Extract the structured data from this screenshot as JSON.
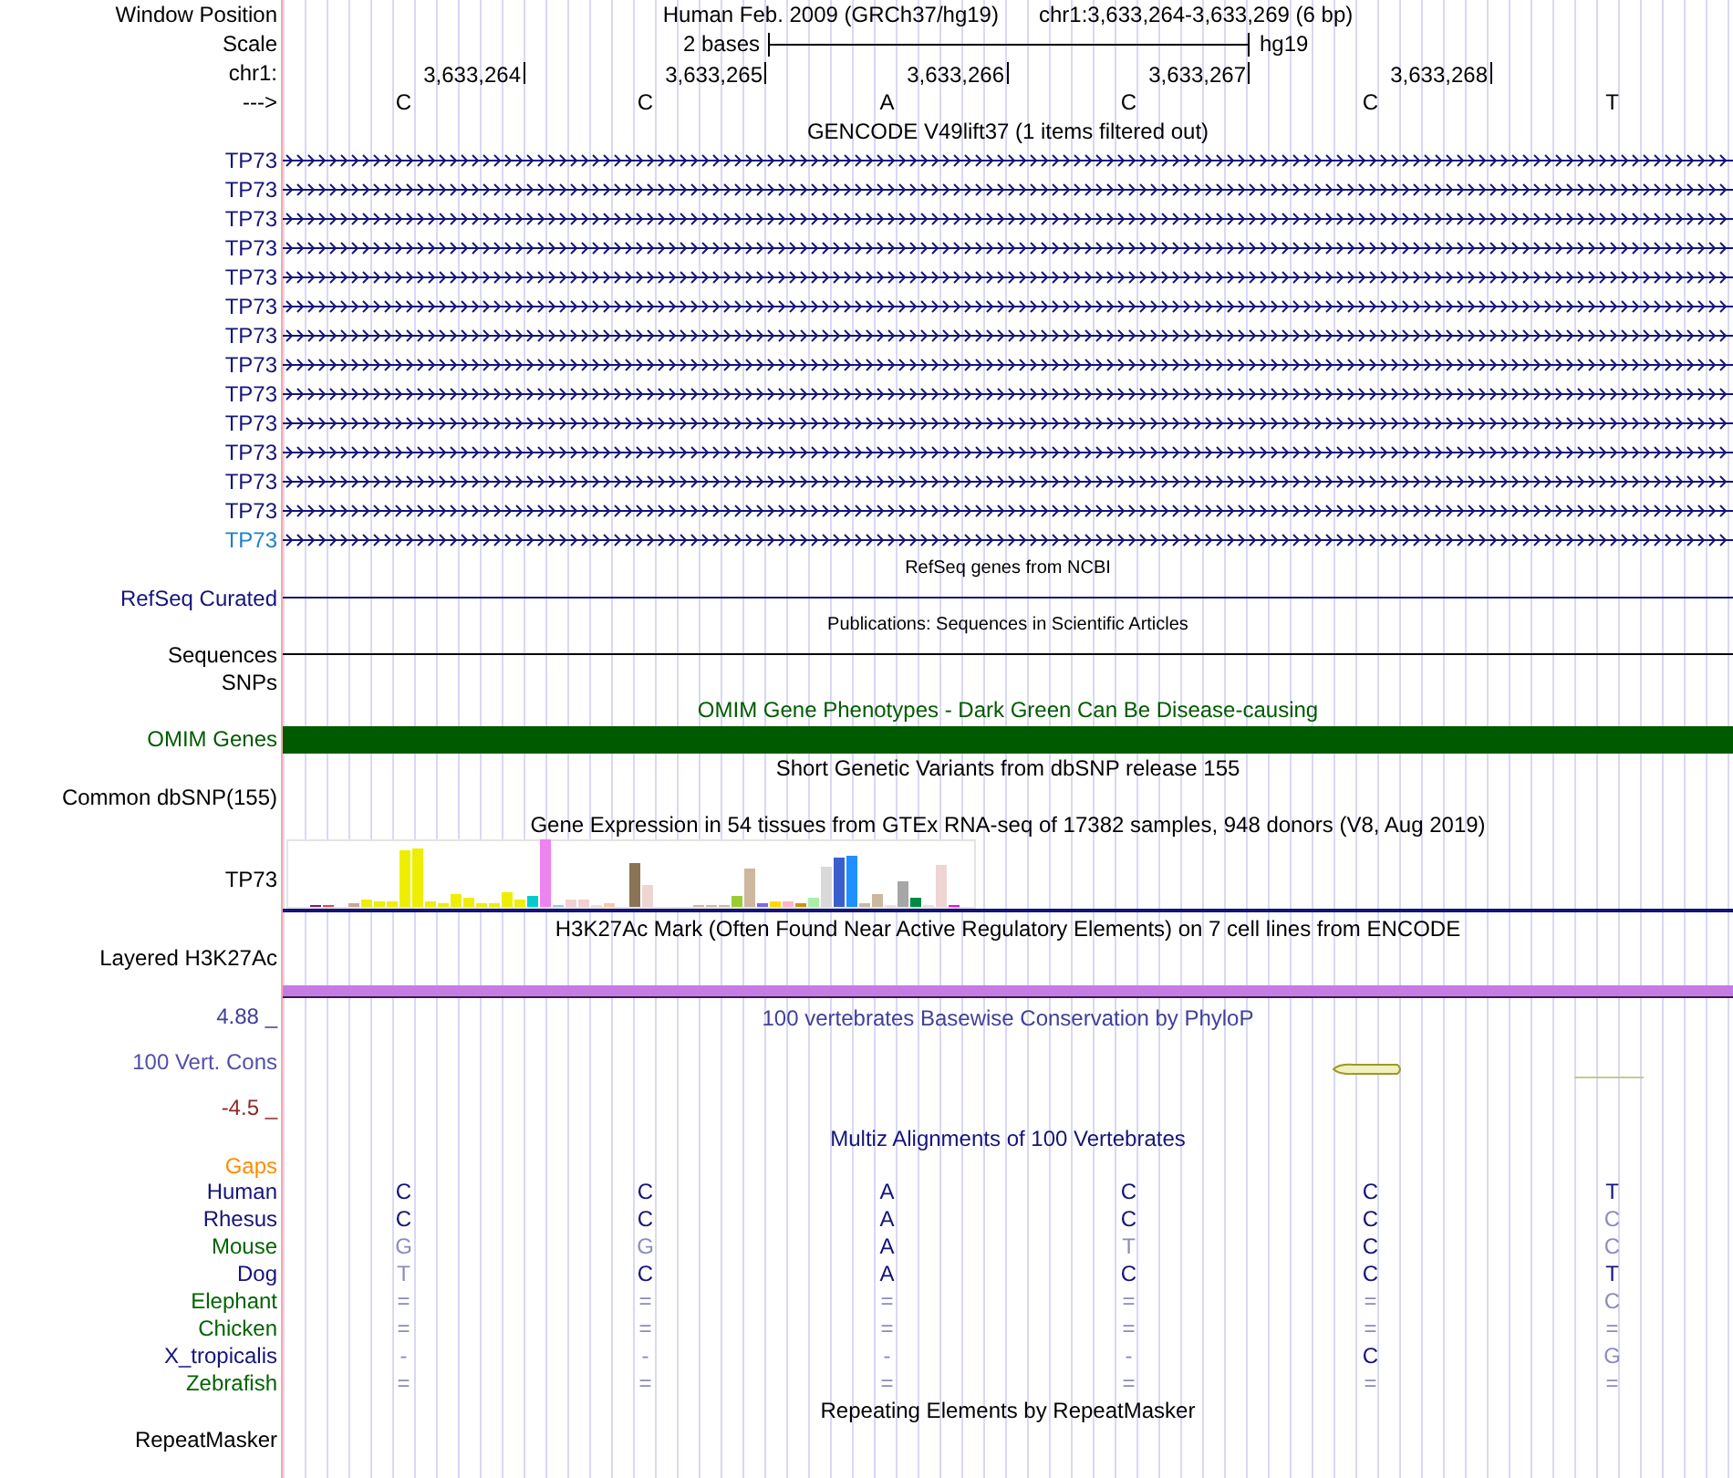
{
  "header": {
    "position_label": "Window Position",
    "assembly": "Human Feb. 2009 (GRCh37/hg19)",
    "position": "chr1:3,633,264-3,633,269 (6 bp)",
    "scale_label": "Scale",
    "scale_text": "2 bases",
    "scale_db": "hg19",
    "chrom_label": "chr1:",
    "ticks": [
      "3,633,264",
      "3,633,265",
      "3,633,266",
      "3,633,267",
      "3,633,268"
    ],
    "strand_label": "--->",
    "bases": [
      "C",
      "C",
      "A",
      "C",
      "C",
      "T"
    ]
  },
  "tracks": [
    {
      "kind": "genes",
      "title": {
        "text": "GENCODE V49lift37 (1 items filtered out)",
        "color": "#000000"
      },
      "items": [
        {
          "label": "TP73",
          "color": "#14147a"
        },
        {
          "label": "TP73",
          "color": "#14147a"
        },
        {
          "label": "TP73",
          "color": "#14147a"
        },
        {
          "label": "TP73",
          "color": "#14147a"
        },
        {
          "label": "TP73",
          "color": "#14147a"
        },
        {
          "label": "TP73",
          "color": "#14147a"
        },
        {
          "label": "TP73",
          "color": "#14147a"
        },
        {
          "label": "TP73",
          "color": "#14147a"
        },
        {
          "label": "TP73",
          "color": "#14147a"
        },
        {
          "label": "TP73",
          "color": "#14147a"
        },
        {
          "label": "TP73",
          "color": "#14147a"
        },
        {
          "label": "TP73",
          "color": "#14147a"
        },
        {
          "label": "TP73",
          "color": "#14147a"
        },
        {
          "label": "TP73",
          "color": "#1e82c8"
        }
      ]
    },
    {
      "kind": "line",
      "title": {
        "text": "RefSeq genes from NCBI",
        "color": "#000000"
      },
      "label": {
        "text": "RefSeq Curated",
        "color": "#14147a"
      }
    },
    {
      "kind": "line",
      "title": {
        "text": "Publications: Sequences in Scientific Articles",
        "color": "#000000"
      },
      "label": {
        "text": "Sequences",
        "color": "#000000"
      }
    },
    {
      "kind": "plain",
      "label": {
        "text": "SNPs",
        "color": "#000000"
      }
    },
    {
      "kind": "bar",
      "title": {
        "text": "OMIM Gene Phenotypes - Dark Green Can Be Disease-causing",
        "color": "#005a00"
      },
      "label": {
        "text": "OMIM Genes",
        "color": "#005a00"
      }
    },
    {
      "kind": "plain",
      "title": {
        "text": "Short Genetic Variants from dbSNP release 155",
        "color": "#000000"
      },
      "label": {
        "text": "Common dbSNP(155)",
        "color": "#000000"
      }
    },
    {
      "kind": "expression",
      "title": {
        "text": "Gene Expression in 54 tissues from GTEx RNA-seq of 17382 samples, 948 donors (V8, Aug 2019)",
        "color": "#000000"
      },
      "label": {
        "text": "TP73",
        "color": "#000000"
      }
    },
    {
      "kind": "density",
      "title": {
        "text": "H3K27Ac Mark (Often Found Near Active Regulatory Elements) on 7 cell lines from ENCODE",
        "color": "#000000"
      },
      "label": {
        "text": "Layered H3K27Ac",
        "color": "#000000"
      }
    },
    {
      "kind": "signal",
      "title": {
        "text": "100 vertebrates Basewise Conservation by PhyloP",
        "color": "#40409a"
      },
      "labels": [
        {
          "text": "4.88 _",
          "color": "#40409a"
        },
        {
          "text": "100 Vert. Cons",
          "color": "#5050a8"
        },
        {
          "text": "-4.5 _",
          "color": "#8c2a2a"
        }
      ]
    },
    {
      "kind": "multiz",
      "title": {
        "text": "Multiz Alignments of 100 Vertebrates",
        "color": "#14147a"
      },
      "gaps_label": {
        "text": "Gaps",
        "color": "#ff8c00"
      },
      "species": [
        {
          "name": "Human",
          "color": "#14147a",
          "bases": [
            {
              "base": "C",
              "match": true
            },
            {
              "base": "C",
              "match": true
            },
            {
              "base": "A",
              "match": true
            },
            {
              "base": "C",
              "match": true
            },
            {
              "base": "C",
              "match": true
            },
            {
              "base": "T",
              "match": true
            }
          ]
        },
        {
          "name": "Rhesus",
          "color": "#14147a",
          "bases": [
            {
              "base": "C",
              "match": true
            },
            {
              "base": "C",
              "match": true
            },
            {
              "base": "A",
              "match": true
            },
            {
              "base": "C",
              "match": true
            },
            {
              "base": "C",
              "match": true
            },
            {
              "base": "C",
              "match": false
            }
          ]
        },
        {
          "name": "Mouse",
          "color": "#006400",
          "bases": [
            {
              "base": "G",
              "match": false
            },
            {
              "base": "G",
              "match": false
            },
            {
              "base": "A",
              "match": true
            },
            {
              "base": "T",
              "match": false
            },
            {
              "base": "C",
              "match": true
            },
            {
              "base": "C",
              "match": false
            }
          ]
        },
        {
          "name": "Dog",
          "color": "#14147a",
          "bases": [
            {
              "base": "T",
              "match": false
            },
            {
              "base": "C",
              "match": true
            },
            {
              "base": "A",
              "match": true
            },
            {
              "base": "C",
              "match": true
            },
            {
              "base": "C",
              "match": true
            },
            {
              "base": "T",
              "match": true
            }
          ]
        },
        {
          "name": "Elephant",
          "color": "#006400",
          "bases": [
            {
              "base": "=",
              "match": false
            },
            {
              "base": "=",
              "match": false
            },
            {
              "base": "=",
              "match": false
            },
            {
              "base": "=",
              "match": false
            },
            {
              "base": "=",
              "match": false
            },
            {
              "base": "C",
              "match": false
            }
          ]
        },
        {
          "name": "Chicken",
          "color": "#006400",
          "bases": [
            {
              "base": "=",
              "match": false
            },
            {
              "base": "=",
              "match": false
            },
            {
              "base": "=",
              "match": false
            },
            {
              "base": "=",
              "match": false
            },
            {
              "base": "=",
              "match": false
            },
            {
              "base": "=",
              "match": false
            }
          ]
        },
        {
          "name": "X_tropicalis",
          "color": "#14147a",
          "bases": [
            {
              "base": "-",
              "match": false
            },
            {
              "base": "-",
              "match": false
            },
            {
              "base": "-",
              "match": false
            },
            {
              "base": "-",
              "match": false
            },
            {
              "base": "C",
              "match": true
            },
            {
              "base": "G",
              "match": false
            }
          ]
        },
        {
          "name": "Zebrafish",
          "color": "#006400",
          "bases": [
            {
              "base": "=",
              "match": false
            },
            {
              "base": "=",
              "match": false
            },
            {
              "base": "=",
              "match": false
            },
            {
              "base": "=",
              "match": false
            },
            {
              "base": "=",
              "match": false
            },
            {
              "base": "=",
              "match": false
            }
          ]
        }
      ]
    },
    {
      "kind": "plain",
      "title": {
        "text": "Repeating Elements by RepeatMasker",
        "color": "#000000"
      },
      "label": {
        "text": "RepeatMasker",
        "color": "#000000"
      }
    }
  ]
}
